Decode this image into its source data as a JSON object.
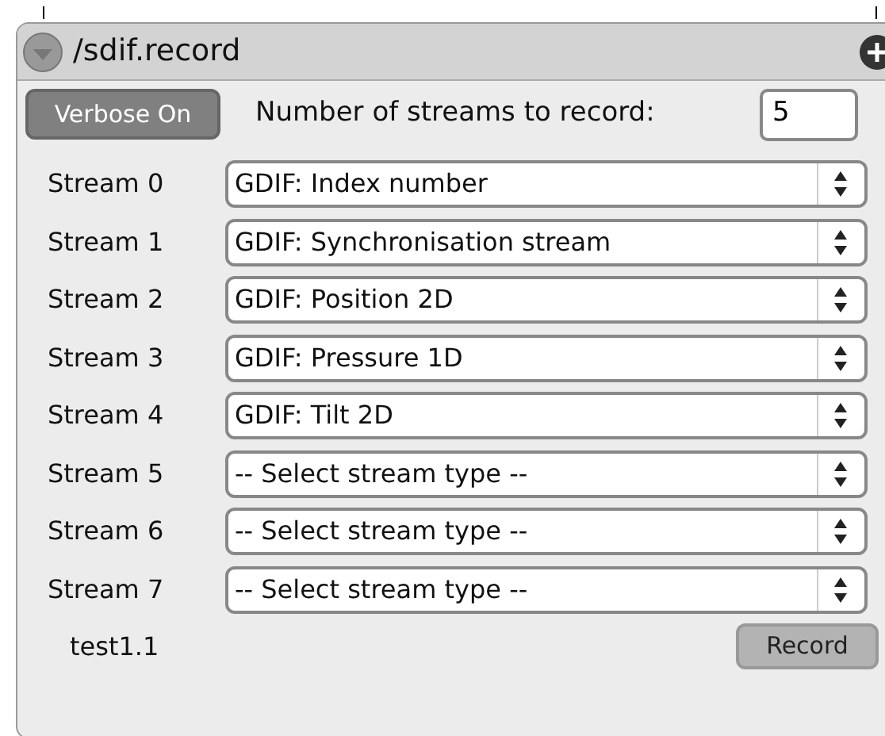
{
  "window": {
    "title": "/sdif.record"
  },
  "verbose_button": {
    "label": "Verbose On"
  },
  "stream_count": {
    "label": "Number of streams to record:",
    "value": "5"
  },
  "streams": [
    {
      "label": "Stream 0",
      "value": "GDIF: Index number"
    },
    {
      "label": "Stream 1",
      "value": "GDIF: Synchronisation stream"
    },
    {
      "label": "Stream 2",
      "value": "GDIF: Position 2D"
    },
    {
      "label": "Stream 3",
      "value": "GDIF: Pressure 1D"
    },
    {
      "label": "Stream 4",
      "value": "GDIF: Tilt 2D"
    },
    {
      "label": "Stream 5",
      "value": "-- Select stream type --"
    },
    {
      "label": "Stream 6",
      "value": "-- Select stream type --"
    },
    {
      "label": "Stream 7",
      "value": "-- Select stream type --"
    }
  ],
  "footer": {
    "name": "test1.1",
    "record_button": "Record"
  }
}
